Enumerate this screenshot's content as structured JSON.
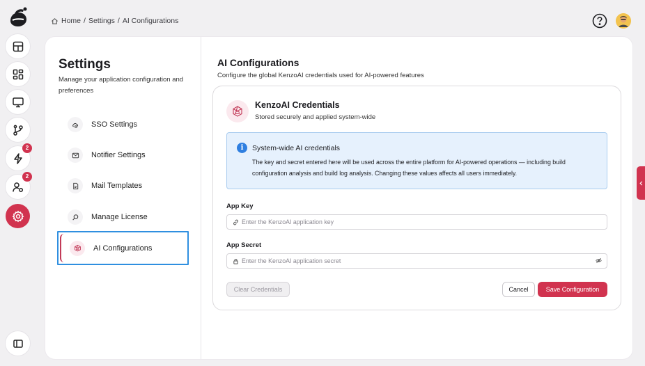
{
  "breadcrumb": {
    "home": "Home",
    "sep1": "/",
    "settings": "Settings",
    "sep2": "/",
    "current": "AI Configurations"
  },
  "rail": {
    "badges": {
      "activity": "2",
      "user_settings": "2"
    }
  },
  "settings": {
    "title": "Settings",
    "subtitle": "Manage your application configuration and preferences",
    "items": [
      {
        "label": "SSO Settings",
        "icon": "cloud-lock-icon"
      },
      {
        "label": "Notifier Settings",
        "icon": "mail-icon"
      },
      {
        "label": "Mail Templates",
        "icon": "file-icon"
      },
      {
        "label": "Manage License",
        "icon": "key-search-icon"
      },
      {
        "label": "AI Configurations",
        "icon": "ai-icon",
        "active": true
      }
    ]
  },
  "content": {
    "title": "AI Configurations",
    "subtitle": "Configure the global KenzoAI credentials used for AI-powered features",
    "card": {
      "title": "KenzoAI Credentials",
      "subtitle": "Stored securely and applied system-wide",
      "info": {
        "title": "System-wide AI credentials",
        "body": "The key and secret entered here will be used across the entire platform for AI-powered operations — including build configuration analysis and build log analysis. Changing these values affects all users immediately."
      },
      "app_key": {
        "label": "App Key",
        "value": "",
        "placeholder": "Enter the KenzoAI application key"
      },
      "app_secret": {
        "label": "App Secret",
        "value": "",
        "placeholder": "Enter the KenzoAI application secret"
      },
      "buttons": {
        "clear": "Clear Credentials",
        "cancel": "Cancel",
        "save": "Save Configuration"
      }
    }
  },
  "colors": {
    "accent": "#d1334f",
    "info_bg": "#e6f1fd",
    "info_border": "#a9ccef",
    "focus_outline": "#2f8fe0"
  }
}
